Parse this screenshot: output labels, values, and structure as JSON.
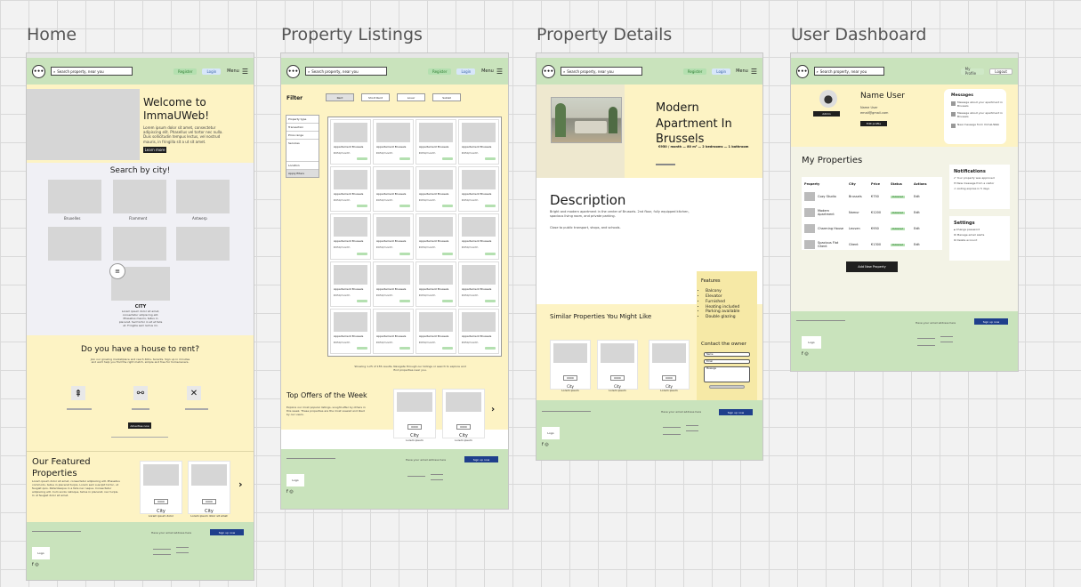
{
  "frames": {
    "home_title": "Home",
    "listings_title": "Property Listings",
    "details_title": "Property Details",
    "dashboard_title": "User Dashboard"
  },
  "nav": {
    "logo": "•••",
    "search_placeholder": "Search property, near you",
    "register": "Register",
    "login": "Login",
    "menu": "Menu",
    "burger": "☰"
  },
  "home": {
    "welcome": "Welcome to ImmaUWeb!",
    "welcome_body": "Lorem ipsum dolor sit amet, consectetur adipiscing elit. Phasellus vel tortor nec nulla. Duis sollicitudin tempus lectus, vel nostrud mauris, in fringilla sit a ut sit amet.",
    "learn_more": "Learn more",
    "search_by_city": "Search by city!",
    "cities": [
      "Bruxelles",
      "Flamment",
      "Antwerp"
    ],
    "city_label": "CITY",
    "city_desc": "Lorem ipsum dolor sit amet, consectetur adipiscing elit. Phasellus mauris, tellus in placerat. Sed tortor in sit et felis at. Fringilla sem lectus mi.",
    "house_q": "Do you have a house to rent?",
    "house_body": "Join our growing marketplace and reach 400+ tenants. Sign up in minutes and we'll help you find the right match, simple and free for homeowners.",
    "advertise": "Advertise now",
    "featured_title": "Our Featured Properties",
    "featured_body": "Lorem ipsum dolor sit amet, consectetur adipiscing elit. Phasellus commodo, tellus in placerat turpis. Lorem sem suscipit tortor, ut feugiat quis. Pellentesque in a felis nec neque. Consectetur adipiscing elit. Cum sociis natoque, tellus in placerat, nec turpis. In ut feugiat dolor sit amet.",
    "featured_cards": [
      {
        "tag": "0000",
        "city": "City",
        "sub": "Lorem ipsum dolor"
      },
      {
        "tag": "0000",
        "city": "City",
        "sub": "Lorem ipsum dolor sit amet"
      }
    ],
    "next": "›"
  },
  "footer": {
    "newsletter": "Have your email address here",
    "signup": "Sign up now",
    "logo": "Logo",
    "social": "f ◎"
  },
  "listings": {
    "filter": "Filter",
    "filter_buttons": [
      "Rent",
      "Short Rent",
      "Louer",
      "Sublet"
    ],
    "sidebar": [
      "Property type",
      "Transaction",
      "Price range",
      "Services",
      "Location"
    ],
    "apply": "Apply filters",
    "card_title": "Appartement Brussels",
    "card_price": "€950/month",
    "showing": "Showing 1-25 of 155 results. Navigate through our listings or search to explore and find properties near you.",
    "top_offers": "Top Offers of the Week",
    "top_body": "Explore our most popular listings, sought-after by others in this week. These properties are the most viewed and liked by our users.",
    "top_cards": [
      {
        "tag": "0000",
        "city": "City",
        "sub": "Lorem ipsum"
      },
      {
        "tag": "0000",
        "city": "City",
        "sub": "Lorem ipsum"
      }
    ]
  },
  "details": {
    "title": "Modern Apartment In Brussels",
    "specs": "€950 / month — 80 m² — 2 bedrooms — 1 bathroom",
    "desc_title": "Description",
    "desc_body": "Bright and modern apartment in the center of Brussels. 2nd floor, fully equipped kitchen, spacious living room, and private parking.",
    "desc_body2": "Close to public transport, shops, and schools.",
    "features_title": "Features",
    "features": [
      "Balcony",
      "Elevator",
      "Furnished",
      "Heating included",
      "Parking available",
      "Double glazing"
    ],
    "contact_title": "Contact the owner",
    "contact_fields": [
      "Name",
      "Email",
      "Message"
    ],
    "similar": "Similar Properties You Might Like",
    "similar_cards": [
      {
        "tag": "0000",
        "city": "City",
        "sub": "Lorem ipsum"
      },
      {
        "tag": "0000",
        "city": "City",
        "sub": "Lorem ipsum"
      },
      {
        "tag": "0000",
        "city": "City",
        "sub": "Lorem ipsum"
      }
    ]
  },
  "dashboard": {
    "nav_profile": "My Profile",
    "nav_logout": "Logout",
    "name": "Name User",
    "role": "Admin",
    "info": "Name User",
    "email": "email@gmail.com",
    "edit": "Edit profile",
    "messages_title": "Messages",
    "messages": [
      "Message about your apartment in Brussels",
      "Message about your apartment in Brussels",
      "New message from ImmaUWeb"
    ],
    "my_properties": "My Properties",
    "table_headers": [
      "Property",
      "City",
      "Price",
      "Status",
      "Actions"
    ],
    "rows": [
      {
        "name": "Cozy Studio",
        "city": "Brussels",
        "price": "€750",
        "status": "Published",
        "action": "Edit"
      },
      {
        "name": "Modern Apartment",
        "city": "Namur",
        "price": "€1200",
        "status": "Published",
        "action": "Edit"
      },
      {
        "name": "Charming House",
        "city": "Leuven",
        "price": "€950",
        "status": "Published",
        "action": "Edit"
      },
      {
        "name": "Spacious Flat Ghent",
        "city": "Ghent",
        "price": "€1300",
        "status": "Published",
        "action": "Edit"
      }
    ],
    "add": "Add New Property",
    "notif_title": "Notifications",
    "notifications": [
      "Your property was approved",
      "New message from a visitor",
      "Listing expires in 5 days"
    ],
    "settings_title": "Settings",
    "settings": [
      "Change password",
      "Manage email alerts",
      "Delete account"
    ]
  }
}
